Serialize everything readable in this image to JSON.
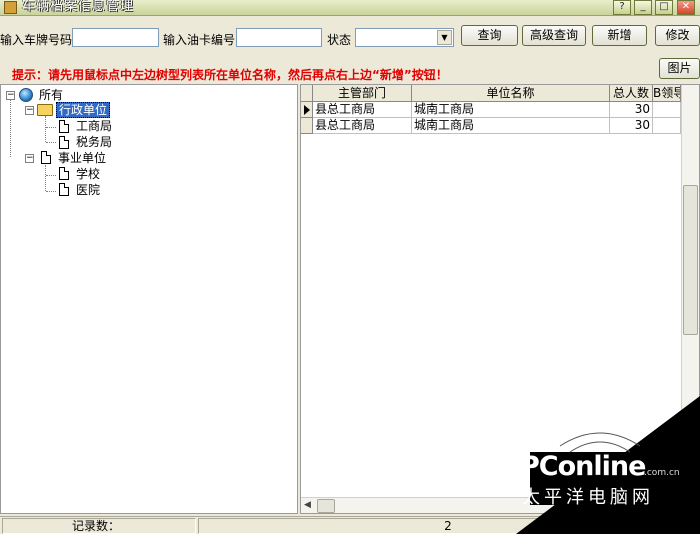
{
  "window": {
    "title": "车辆档案信息管理",
    "controls": {
      "help": "?",
      "minimize": "_",
      "maximize": "□",
      "close": "✕"
    }
  },
  "toolbar": {
    "plate_label": "输入车牌号码",
    "plate_value": "",
    "card_label": "输入油卡编号",
    "card_value": "",
    "status_label": "状态",
    "status_value": "",
    "query_button": "查询",
    "advanced_query_button": "高级查询",
    "add_button": "新增",
    "edit_button": "修改",
    "picture_button": "图片"
  },
  "hint": "提示：请先用鼠标点中左边树型列表所在单位名称，然后再点右上边“新增”按钮！",
  "tree": {
    "root": {
      "label": "所有",
      "icon": "globe-icon"
    },
    "groups": [
      {
        "label": "行政单位",
        "icon": "open-folder-icon",
        "selected": true,
        "children": [
          {
            "label": "工商局"
          },
          {
            "label": "税务局"
          }
        ]
      },
      {
        "label": "事业单位",
        "icon": "document-icon",
        "selected": false,
        "children": [
          {
            "label": "学校"
          },
          {
            "label": "医院"
          }
        ]
      }
    ]
  },
  "grid": {
    "columns": [
      "主管部门",
      "单位名称",
      "总人数",
      "B领导"
    ],
    "rows": [
      {
        "dept": "县总工商局",
        "unit": "城南工商局",
        "count": "30",
        "extra": ""
      },
      {
        "dept": "县总工商局",
        "unit": "城南工商局",
        "count": "30",
        "extra": ""
      }
    ]
  },
  "statusbar": {
    "record_label": "记录数：",
    "record_count": "2"
  },
  "watermark": {
    "brand": "PConline",
    "domain": ".com.cn",
    "cn": "太平洋电脑网"
  },
  "colors": {
    "hint": "#e00000",
    "selection": "#316ac5",
    "titlebar": "#c9d39a"
  }
}
